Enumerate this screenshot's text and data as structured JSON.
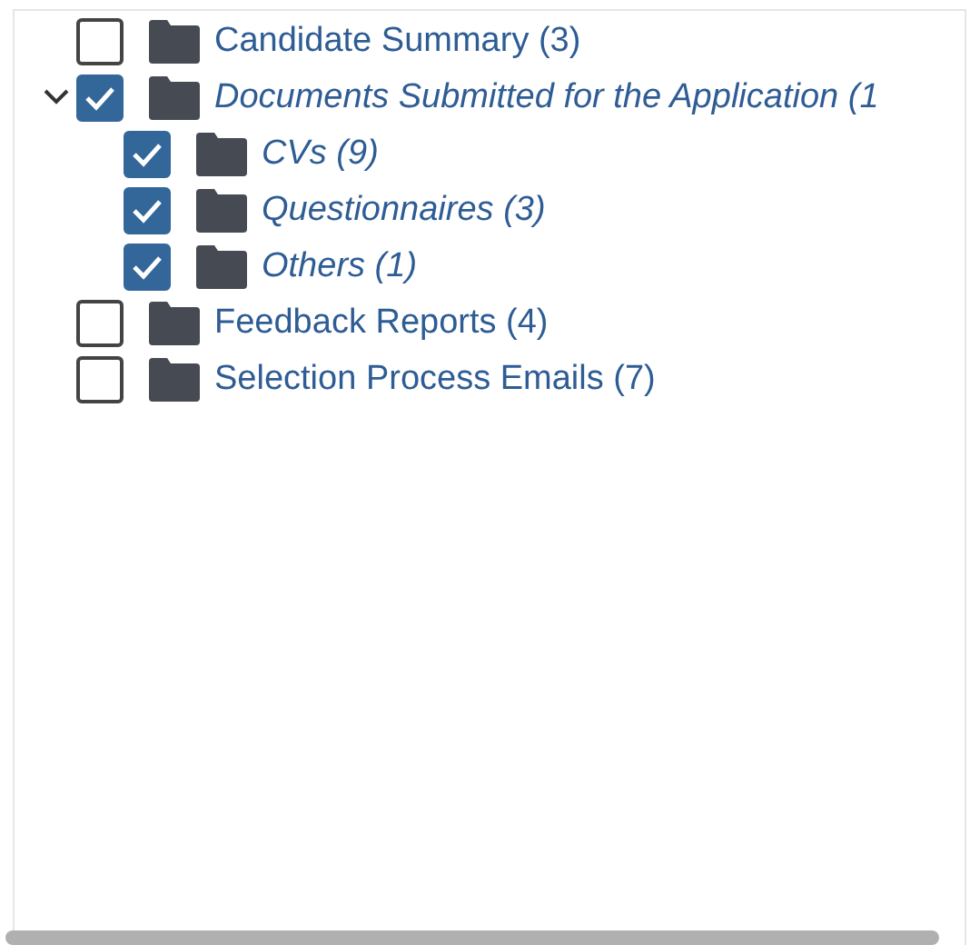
{
  "tree": [
    {
      "label": "Candidate Summary (3)",
      "checked": false
    },
    {
      "label": "Documents Submitted for the Application (1",
      "checked": true,
      "expanded": true,
      "children": [
        {
          "label": "CVs (9)",
          "checked": true
        },
        {
          "label": "Questionnaires (3)",
          "checked": true
        },
        {
          "label": "Others (1)",
          "checked": true
        }
      ]
    },
    {
      "label": "Feedback Reports (4)",
      "checked": false
    },
    {
      "label": "Selection Process Emails (7)",
      "checked": false
    }
  ]
}
